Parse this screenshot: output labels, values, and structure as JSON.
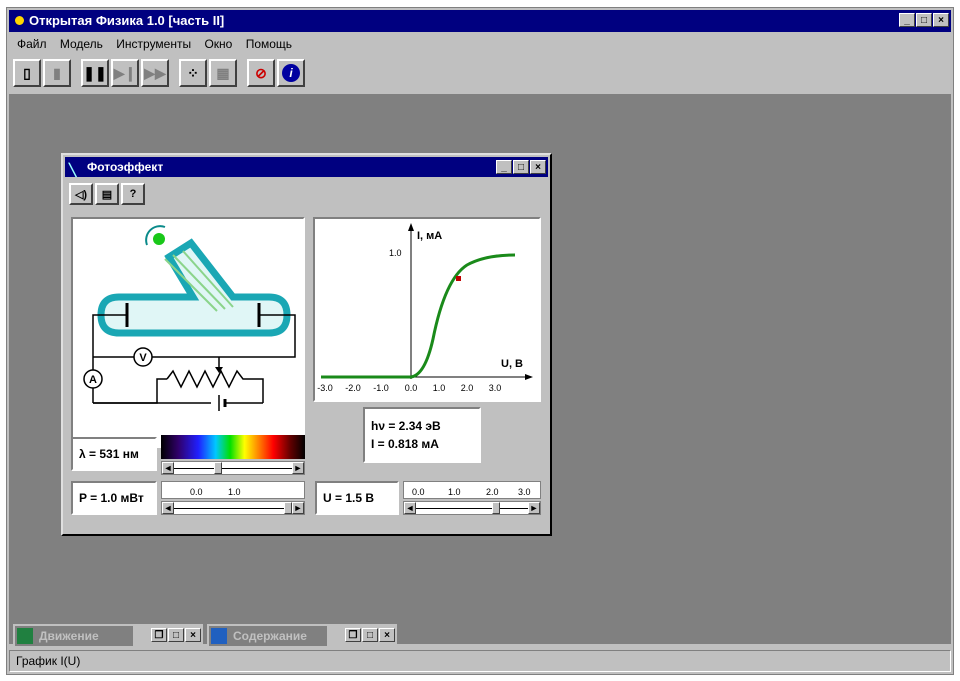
{
  "app": {
    "title": "Открытая Физика 1.0 [часть II]",
    "min": "_",
    "max": "□",
    "close": "×"
  },
  "menu": [
    "Файл",
    "Модель",
    "Инструменты",
    "Окно",
    "Помощь"
  ],
  "window": {
    "title": "Фотоэффект",
    "min": "_",
    "max": "□",
    "close": "×",
    "tool_help": "?"
  },
  "circuit": {
    "voltmeter": "V",
    "ammeter": "A"
  },
  "graph": {
    "y_label": "I, мА",
    "y_tick": "1.0",
    "x_label": "U, B",
    "x_ticks": [
      "-3.0",
      "-2.0",
      "-1.0",
      "0.0",
      "1.0",
      "2.0",
      "3.0"
    ]
  },
  "readouts": {
    "wavelength": "λ = 531 нм",
    "power": "P = 1.0 мВт",
    "voltage": "U = 1.5 В",
    "photon_energy": "hν = 2.34 эВ",
    "current": "I = 0.818 мА"
  },
  "power_scale": [
    "0.0",
    "1.0"
  ],
  "voltage_scale": [
    "0.0",
    "1.0",
    "2.0",
    "3.0"
  ],
  "minimized": [
    {
      "title": "Движение"
    },
    {
      "title": "Содержание"
    }
  ],
  "status": "График I(U)",
  "colors": {
    "title_bar": "#000080",
    "desktop": "#808080",
    "curve": "#1a8a1a"
  }
}
